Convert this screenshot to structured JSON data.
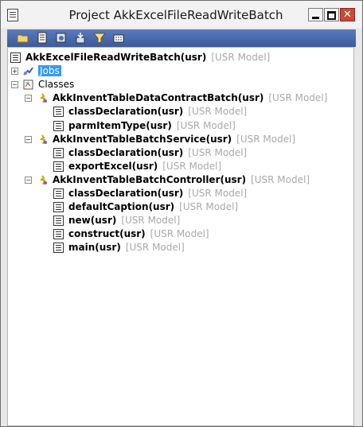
{
  "window": {
    "title": "Project AkkExcelFileReadWriteBatch",
    "close_glyph": "✕"
  },
  "tree": {
    "root": {
      "name": "AkkExcelFileReadWriteBatch(usr)",
      "layer": "[USR Model]"
    },
    "jobs": {
      "name": "Jobs"
    },
    "classes": {
      "name": "Classes"
    },
    "class_list": [
      {
        "name": "AkkInventTableDataContractBatch(usr)",
        "layer": "[USR Model]",
        "methods": [
          {
            "name": "classDeclaration(usr)",
            "layer": "[USR Model]"
          },
          {
            "name": "parmItemType(usr)",
            "layer": "[USR Model]"
          }
        ]
      },
      {
        "name": "AkkInventTableBatchService(usr)",
        "layer": "[USR Model]",
        "methods": [
          {
            "name": "classDeclaration(usr)",
            "layer": "[USR Model]"
          },
          {
            "name": "exportExcel(usr)",
            "layer": "[USR Model]"
          }
        ]
      },
      {
        "name": "AkkInventTableBatchController(usr)",
        "layer": "[USR Model]",
        "methods": [
          {
            "name": "classDeclaration(usr)",
            "layer": "[USR Model]"
          },
          {
            "name": "defaultCaption(usr)",
            "layer": "[USR Model]"
          },
          {
            "name": "new(usr)",
            "layer": "[USR Model]"
          },
          {
            "name": "construct(usr)",
            "layer": "[USR Model]"
          },
          {
            "name": "main(usr)",
            "layer": "[USR Model]"
          }
        ]
      }
    ]
  }
}
